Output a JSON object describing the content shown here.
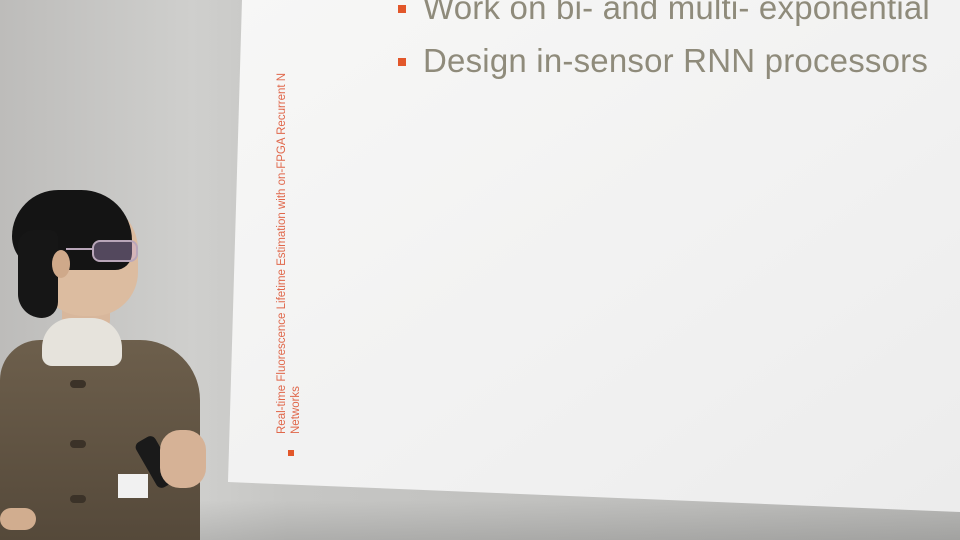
{
  "slide": {
    "bullets": [
      "Work on bi- and multi- exponential",
      "Design in-sensor RNN processors"
    ],
    "footer_line1": "Real-time Fluorescence Lifetime Estimation with on-FPGA Recurrent N",
    "footer_line2": "Networks"
  },
  "colors": {
    "accent": "#e2572a",
    "bullet_text": "#8f8b7b",
    "footer_text": "#e0674a"
  }
}
